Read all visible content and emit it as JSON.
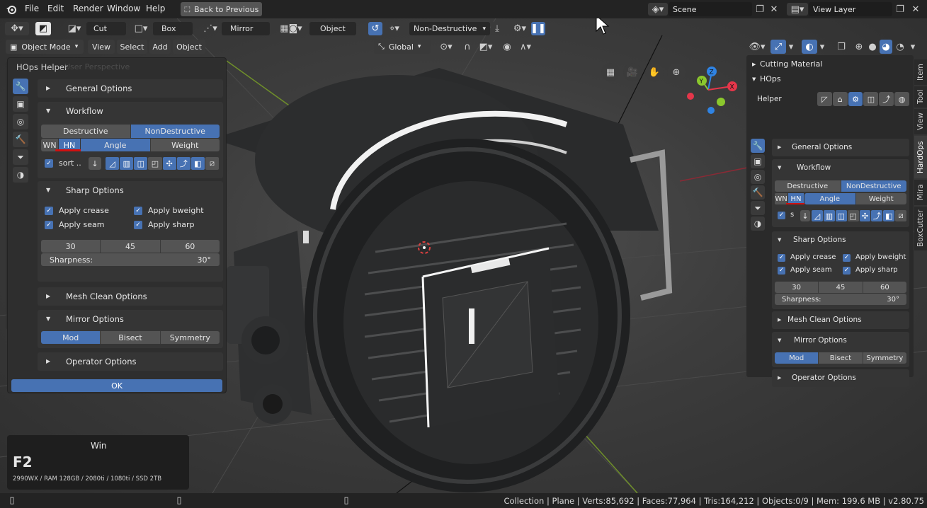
{
  "topbar": {
    "menu": [
      "File",
      "Edit",
      "Render",
      "Window",
      "Help"
    ],
    "back_button": "Back to Previous",
    "scene": "Scene",
    "view_layer": "View Layer"
  },
  "toolheader": {
    "cut": "Cut",
    "box": "Box",
    "mirror": "Mirror",
    "object": "Object",
    "non_destructive": "Non-Destructive"
  },
  "header": {
    "mode": "Object Mode",
    "menus": [
      "View",
      "Select",
      "Add",
      "Object"
    ],
    "orientation": "Global"
  },
  "viewport": {
    "perspective_label": "User Perspective"
  },
  "hops_popup": {
    "title": "HOps Helper",
    "general": "General Options",
    "workflow": "Workflow",
    "destructive": "Destructive",
    "nondestructive": "NonDestructive",
    "wn": "WN",
    "hn": "HN",
    "angle": "Angle",
    "weight": "Weight",
    "sort": "sort ..",
    "sharp": "Sharp Options",
    "apply_crease": "Apply crease",
    "apply_bweight": "Apply bweight",
    "apply_seam": "Apply seam",
    "apply_sharp": "Apply sharp",
    "angles": [
      "30",
      "45",
      "60"
    ],
    "sharpness_label": "Sharpness:",
    "sharpness_value": "30°",
    "mesh_clean": "Mesh Clean Options",
    "mirror": "Mirror Options",
    "mod": "Mod",
    "bisect": "Bisect",
    "symmetry": "Symmetry",
    "operator": "Operator Options",
    "ok": "OK"
  },
  "sidebar": {
    "cutting_material": "Cutting Material",
    "hops": "HOps",
    "helper": "Helper",
    "general": "General Options",
    "workflow": "Workflow",
    "destructive": "Destructive",
    "nondestructive": "NonDestructive",
    "wn": "WN",
    "hn": "HN",
    "angle": "Angle",
    "weight": "Weight",
    "sort": "s",
    "sharp": "Sharp Options",
    "apply_crease": "Apply crease",
    "apply_bweight": "Apply bweight",
    "apply_seam": "Apply seam",
    "apply_sharp": "Apply sharp",
    "angles": [
      "30",
      "45",
      "60"
    ],
    "sharpness_label": "Sharpness:",
    "sharpness_value": "30°",
    "mesh_clean": "Mesh Clean Options",
    "mirror": "Mirror Options",
    "mod": "Mod",
    "bisect": "Bisect",
    "symmetry": "Symmetry",
    "operator": "Operator Options",
    "tabs": [
      "Item",
      "Tool",
      "View",
      "HardOps",
      "Mira",
      "BoxCutter"
    ]
  },
  "keycast": {
    "os": "Win",
    "key": "F2",
    "specs": "2990WX / RAM 128GB / 2080ti / 1080ti / SSD 2TB"
  },
  "status": "Collection | Plane | Verts:85,692 | Faces:77,964 | Tris:164,212 | Objects:0/9 | Mem: 199.6 MB | v2.80.75",
  "colors": {
    "accent": "#4772b3",
    "axis_x": "#e5364a",
    "axis_y": "#8bc72d",
    "axis_z": "#2f83e3",
    "marker": "#d01010"
  },
  "icons": [
    "blender-logo-icon",
    "cursor-icon",
    "grid-icon",
    "camera-icon",
    "hand-icon",
    "zoom-icon",
    "wrench-icon",
    "gear-icon"
  ]
}
